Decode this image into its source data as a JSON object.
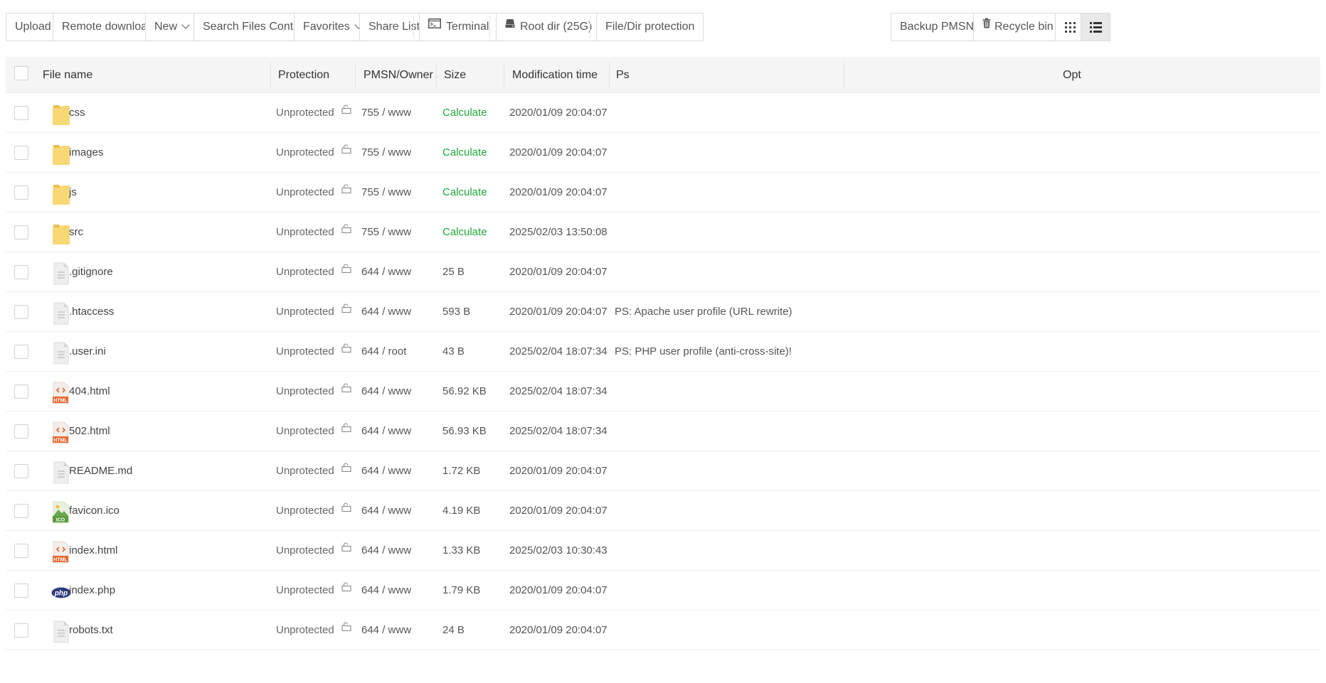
{
  "toolbar": {
    "upload": "Upload",
    "remote_download": "Remote download",
    "new": "New",
    "search_files_content": "Search Files Content",
    "favorites": "Favorites",
    "share_list": "Share List",
    "terminal": "Terminal",
    "root_dir": "Root dir (25G)",
    "file_dir_protection": "File/Dir protection",
    "backup_pmsn": "Backup PMSN",
    "recycle_bin": "Recycle bin",
    "view_mode": "list"
  },
  "table": {
    "headers": {
      "file_name": "File name",
      "protection": "Protection",
      "pmsn_owner": "PMSN/Owner",
      "size": "Size",
      "mtime": "Modification time",
      "ps": "Ps",
      "opt": "Opt"
    },
    "rows": [
      {
        "icon": "folder-icon",
        "name": "css",
        "protection": "Unprotected",
        "perm": "755 / www",
        "size": "Calculate",
        "mtime": "2020/01/09 20:04:07",
        "ps": ""
      },
      {
        "icon": "folder-icon",
        "name": "images",
        "protection": "Unprotected",
        "perm": "755 / www",
        "size": "Calculate",
        "mtime": "2020/01/09 20:04:07",
        "ps": ""
      },
      {
        "icon": "folder-icon",
        "name": "js",
        "protection": "Unprotected",
        "perm": "755 / www",
        "size": "Calculate",
        "mtime": "2020/01/09 20:04:07",
        "ps": ""
      },
      {
        "icon": "folder-icon",
        "name": "src",
        "protection": "Unprotected",
        "perm": "755 / www",
        "size": "Calculate",
        "mtime": "2025/02/03 13:50:08",
        "ps": ""
      },
      {
        "icon": "text-file-icon",
        "name": ".gitignore",
        "protection": "Unprotected",
        "perm": "644 / www",
        "size": "25 B",
        "mtime": "2020/01/09 20:04:07",
        "ps": ""
      },
      {
        "icon": "text-file-icon",
        "name": ".htaccess",
        "protection": "Unprotected",
        "perm": "644 / www",
        "size": "593 B",
        "mtime": "2020/01/09 20:04:07",
        "ps": "PS: Apache user profile (URL rewrite)"
      },
      {
        "icon": "text-file-icon",
        "name": ".user.ini",
        "protection": "Unprotected",
        "perm": "644 / root",
        "size": "43 B",
        "mtime": "2025/02/04 18:07:34",
        "ps": "PS: PHP user profile (anti-cross-site)!"
      },
      {
        "icon": "html-file-icon",
        "name": "404.html",
        "protection": "Unprotected",
        "perm": "644 / www",
        "size": "56.92 KB",
        "mtime": "2025/02/04 18:07:34",
        "ps": ""
      },
      {
        "icon": "html-file-icon",
        "name": "502.html",
        "protection": "Unprotected",
        "perm": "644 / www",
        "size": "56.93 KB",
        "mtime": "2025/02/04 18:07:34",
        "ps": ""
      },
      {
        "icon": "text-file-icon",
        "name": "README.md",
        "protection": "Unprotected",
        "perm": "644 / www",
        "size": "1.72 KB",
        "mtime": "2020/01/09 20:04:07",
        "ps": ""
      },
      {
        "icon": "image-file-icon",
        "name": "favicon.ico",
        "protection": "Unprotected",
        "perm": "644 / www",
        "size": "4.19 KB",
        "mtime": "2020/01/09 20:04:07",
        "ps": ""
      },
      {
        "icon": "html-file-icon",
        "name": "index.html",
        "protection": "Unprotected",
        "perm": "644 / www",
        "size": "1.33 KB",
        "mtime": "2025/02/03 10:30:43",
        "ps": ""
      },
      {
        "icon": "php-file-icon",
        "name": "index.php",
        "protection": "Unprotected",
        "perm": "644 / www",
        "size": "1.79 KB",
        "mtime": "2020/01/09 20:04:07",
        "ps": ""
      },
      {
        "icon": "text-file-icon",
        "name": "robots.txt",
        "protection": "Unprotected",
        "perm": "644 / www",
        "size": "24 B",
        "mtime": "2020/01/09 20:04:07",
        "ps": ""
      }
    ]
  },
  "icon_labels": {
    "html": "HTML",
    "ico": "ICO",
    "php": "php"
  },
  "colors": {
    "accent_green": "#20a53a",
    "folder_yellow": "#f7d36b",
    "html_orange": "#e8672f",
    "php_navy": "#2e3c7e"
  }
}
